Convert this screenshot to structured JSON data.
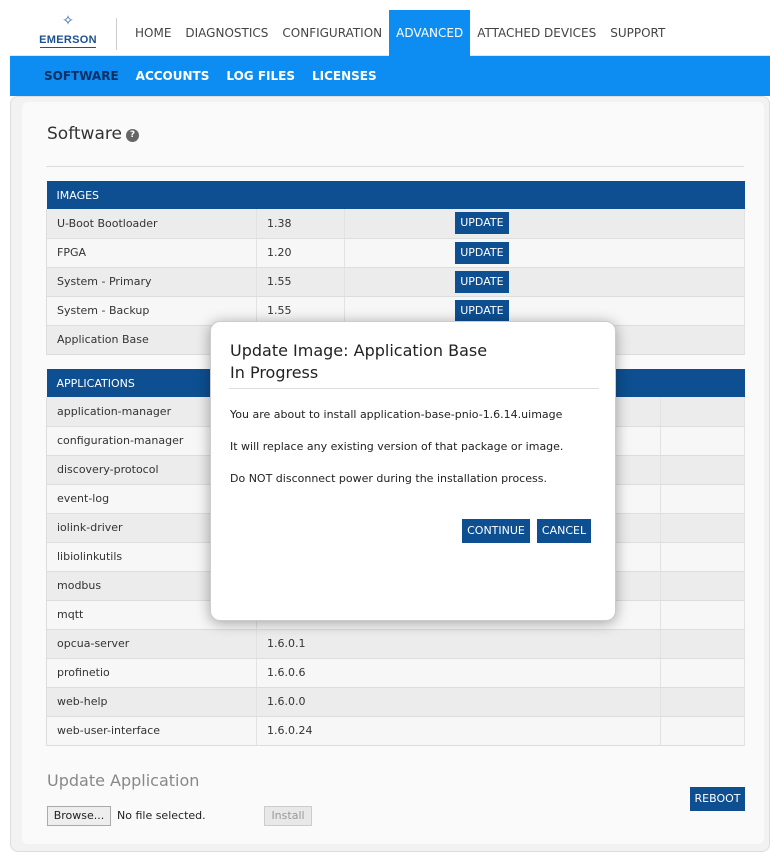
{
  "brand": {
    "logo_text": "EMERSON"
  },
  "topnav": {
    "items": [
      {
        "label": "HOME"
      },
      {
        "label": "DIAGNOSTICS"
      },
      {
        "label": "CONFIGURATION"
      },
      {
        "label": "ADVANCED",
        "active": true
      },
      {
        "label": "ATTACHED DEVICES"
      },
      {
        "label": "SUPPORT"
      }
    ]
  },
  "subnav": {
    "items": [
      {
        "label": "SOFTWARE",
        "active": true
      },
      {
        "label": "ACCOUNTS"
      },
      {
        "label": "LOG FILES"
      },
      {
        "label": "LICENSES"
      }
    ]
  },
  "page": {
    "title": "Software",
    "help_icon": "?"
  },
  "images": {
    "header": "IMAGES",
    "update_label": "UPDATE",
    "rows": [
      {
        "name": "U-Boot Bootloader",
        "version": "1.38"
      },
      {
        "name": "FPGA",
        "version": "1.20"
      },
      {
        "name": "System - Primary",
        "version": "1.55"
      },
      {
        "name": "System - Backup",
        "version": "1.55"
      },
      {
        "name": "Application Base",
        "version": ""
      }
    ]
  },
  "applications": {
    "header": "APPLICATIONS",
    "rows": [
      {
        "name": "application-manager",
        "version": ""
      },
      {
        "name": "configuration-manager",
        "version": ""
      },
      {
        "name": "discovery-protocol",
        "version": ""
      },
      {
        "name": "event-log",
        "version": ""
      },
      {
        "name": "iolink-driver",
        "version": ""
      },
      {
        "name": "libiolinkutils",
        "version": ""
      },
      {
        "name": "modbus",
        "version": ""
      },
      {
        "name": "mqtt",
        "version": ""
      },
      {
        "name": "opcua-server",
        "version": "1.6.0.1"
      },
      {
        "name": "profinetio",
        "version": "1.6.0.6"
      },
      {
        "name": "web-help",
        "version": "1.6.0.0"
      },
      {
        "name": "web-user-interface",
        "version": "1.6.0.24"
      }
    ]
  },
  "update_app": {
    "title": "Update Application",
    "browse_label": "Browse...",
    "file_status": "No file selected.",
    "install_label": "Install",
    "reboot_label": "REBOOT"
  },
  "modal": {
    "title_line1": "Update Image: Application Base",
    "title_line2": "In Progress",
    "msg1": "You are about to install application-base-pnio-1.6.14.uimage",
    "msg2": "It will replace any existing version of that package or image.",
    "msg3": "Do NOT disconnect power during the installation process.",
    "continue_label": "CONTINUE",
    "cancel_label": "CANCEL"
  }
}
